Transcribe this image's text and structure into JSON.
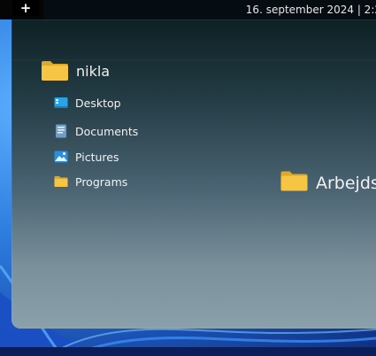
{
  "topbar": {
    "add_label": "+",
    "datetime": "16. september 2024 | 2:2"
  },
  "tree": {
    "root_label": "nikla",
    "items": [
      {
        "label": "Desktop",
        "icon": "desktop-icon"
      },
      {
        "label": "Documents",
        "icon": "document-icon"
      },
      {
        "label": "Pictures",
        "icon": "pictures-icon"
      },
      {
        "label": "Programs",
        "icon": "folder-icon"
      }
    ]
  },
  "content": {
    "folder_label": "Arbejds"
  },
  "colors": {
    "folder_yellow": "#f6c544",
    "folder_dark": "#e0a72a",
    "desktop_blue": "#2aa3e6"
  }
}
